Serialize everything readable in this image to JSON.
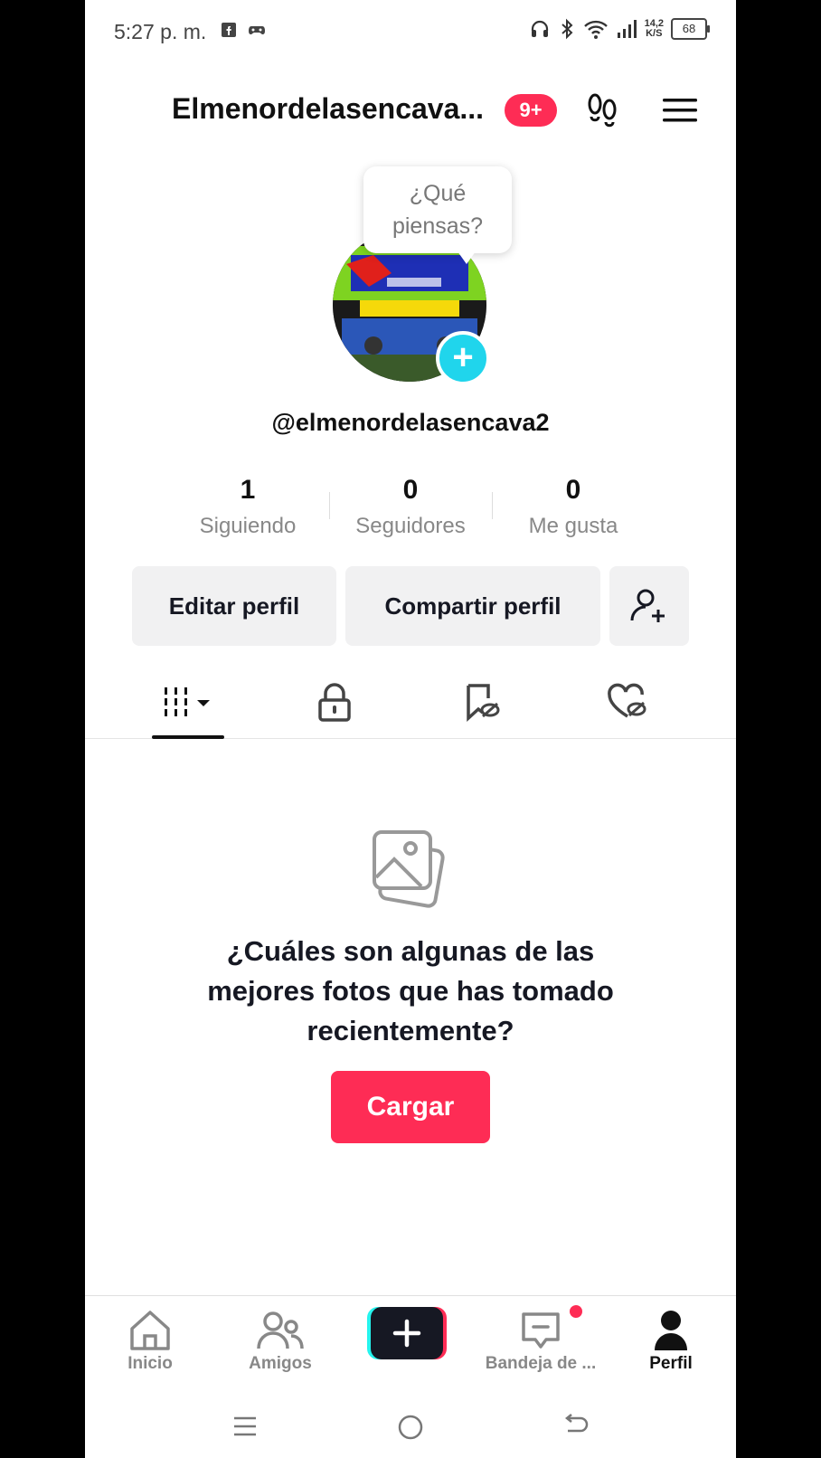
{
  "status_bar": {
    "time": "5:27 p. m.",
    "net_speed_value": "14,2",
    "net_speed_unit": "K/S",
    "battery": "68"
  },
  "header": {
    "title": "Elmenordelasencava...",
    "notification_badge": "9+"
  },
  "profile": {
    "bubble_text": "¿Qué piensas?",
    "handle": "@elmenordelasencava2",
    "stats": [
      {
        "value": "1",
        "label": "Siguiendo"
      },
      {
        "value": "0",
        "label": "Seguidores"
      },
      {
        "value": "0",
        "label": "Me gusta"
      }
    ],
    "edit_button": "Editar perfil",
    "share_button": "Compartir perfil"
  },
  "empty_state": {
    "message": "¿Cuáles son algunas de las mejores fotos que has tomado recientemente?",
    "upload_button": "Cargar"
  },
  "bottom_nav": {
    "items": [
      {
        "label": "Inicio",
        "icon": "home-icon"
      },
      {
        "label": "Amigos",
        "icon": "friends-icon"
      },
      {
        "label": "",
        "icon": "create-plus-icon"
      },
      {
        "label": "Bandeja de ...",
        "icon": "inbox-icon"
      },
      {
        "label": "Perfil",
        "icon": "profile-icon"
      }
    ]
  },
  "colors": {
    "accent": "#fe2c55",
    "add_avatar": "#20d5ec"
  }
}
